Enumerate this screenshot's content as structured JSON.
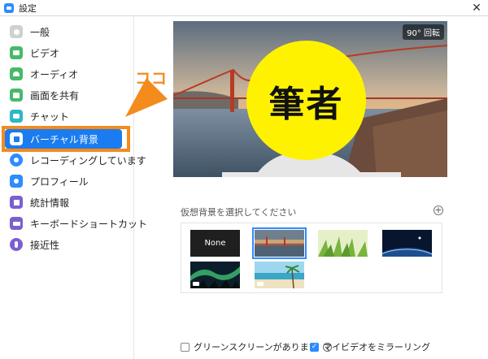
{
  "window": {
    "title": "設定",
    "close_glyph": "✕"
  },
  "sidebar": {
    "items": [
      {
        "label": "一般",
        "icon": "gear-icon",
        "color": "#d0d0d0"
      },
      {
        "label": "ビデオ",
        "icon": "video-icon",
        "color": "#48b96b"
      },
      {
        "label": "オーディオ",
        "icon": "headphones-icon",
        "color": "#48b96b"
      },
      {
        "label": "画面を共有",
        "icon": "share-screen-icon",
        "color": "#48b96b"
      },
      {
        "label": "チャット",
        "icon": "chat-icon",
        "color": "#2fb6c7"
      },
      {
        "label": "バーチャル背景",
        "icon": "virtual-background-icon",
        "color": "#1a7cf0"
      },
      {
        "label": "レコーディングしています",
        "icon": "record-icon",
        "color": "#2d8cff"
      },
      {
        "label": "プロフィール",
        "icon": "profile-icon",
        "color": "#2d8cff"
      },
      {
        "label": "統計情報",
        "icon": "statistics-icon",
        "color": "#7b5fd0"
      },
      {
        "label": "キーボードショートカット",
        "icon": "keyboard-icon",
        "color": "#7b5fd0"
      },
      {
        "label": "接近性",
        "icon": "accessibility-icon",
        "color": "#7b5fd0"
      }
    ],
    "active_index": 5
  },
  "annotation": {
    "text": "ココ",
    "color": "#f38b1d"
  },
  "preview": {
    "rotate_label": "90° 回転",
    "writer_label": "筆者"
  },
  "background_section": {
    "label": "仮想背景を選択してください",
    "add_glyph": "+",
    "thumbnails": [
      {
        "name": "none",
        "label": "None",
        "selected": false
      },
      {
        "name": "golden-gate",
        "label": "",
        "selected": true
      },
      {
        "name": "grass",
        "label": "",
        "selected": false
      },
      {
        "name": "earth",
        "label": "",
        "selected": false
      },
      {
        "name": "aurora",
        "label": "",
        "selected": false,
        "video": true
      },
      {
        "name": "beach",
        "label": "",
        "selected": false,
        "video": true
      }
    ]
  },
  "options": {
    "green_screen": {
      "label": "グリーンスクリーンがあります",
      "checked": false,
      "help_glyph": "?"
    },
    "mirror_video": {
      "label": "マイビデオをミラーリング",
      "checked": true
    }
  },
  "colors": {
    "accent": "#1a7cf0",
    "annotation": "#f38b1d",
    "badge": "#fff201"
  }
}
